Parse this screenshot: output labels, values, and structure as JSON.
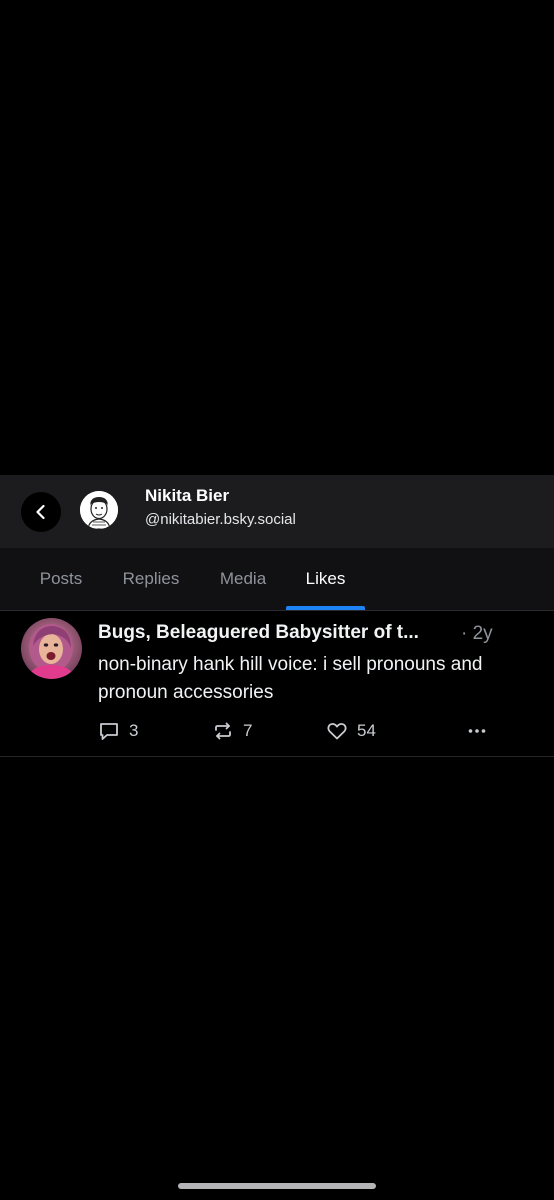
{
  "profile": {
    "display_name": "Nikita Bier",
    "handle": "@nikitabier.bsky.social"
  },
  "tabs": [
    {
      "label": "Posts",
      "active": false
    },
    {
      "label": "Replies",
      "active": false
    },
    {
      "label": "Media",
      "active": false
    },
    {
      "label": "Likes",
      "active": true
    }
  ],
  "post": {
    "author": "Bugs, Beleaguered Babysitter of t...",
    "time": "· 2y",
    "text": "non-binary hank hill voice: i sell pronouns and pronoun accessories",
    "reply_count": "3",
    "repost_count": "7",
    "like_count": "54"
  },
  "icons": {
    "back": "chevron-left-icon",
    "reply": "speech-bubble-icon",
    "repost": "repost-arrows-icon",
    "like": "heart-icon",
    "more": "ellipsis-icon"
  },
  "colors": {
    "background": "#000000",
    "header_bg": "#1c1c1e",
    "tab_bg": "#111113",
    "accent": "#1d82f5",
    "muted_text": "#8f939b"
  }
}
